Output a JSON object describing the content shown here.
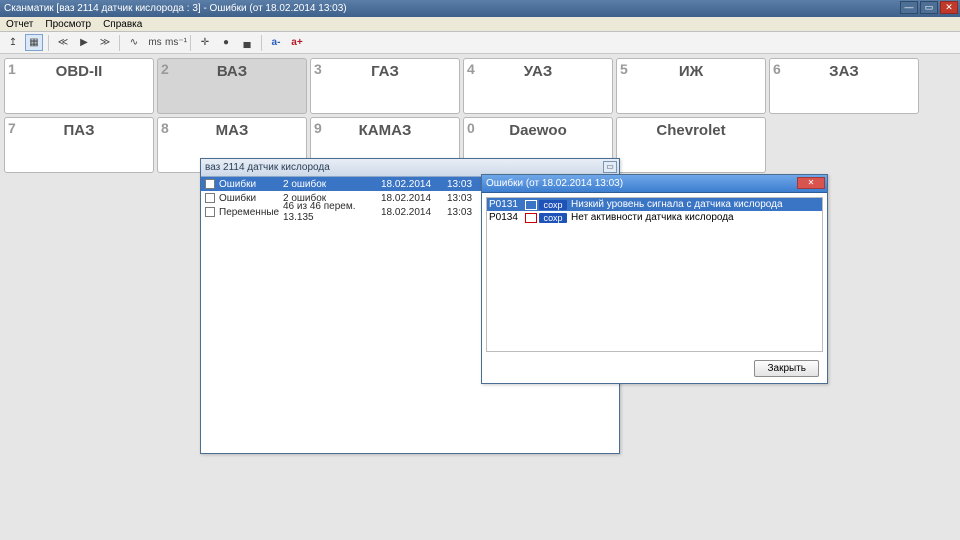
{
  "app": {
    "title": "Сканматик [ваз 2114 датчик кислорода : 3] - Ошибки (от 18.02.2014  13:03)"
  },
  "menu": {
    "report": "Отчет",
    "view": "Просмотр",
    "help": "Справка"
  },
  "cards": [
    {
      "num": "1",
      "label": "OBD-II"
    },
    {
      "num": "2",
      "label": "ВАЗ",
      "selected": true
    },
    {
      "num": "3",
      "label": "ГАЗ"
    },
    {
      "num": "4",
      "label": "УАЗ"
    },
    {
      "num": "5",
      "label": "ИЖ"
    },
    {
      "num": "6",
      "label": "ЗАЗ"
    },
    {
      "num": "7",
      "label": "ПАЗ"
    },
    {
      "num": "8",
      "label": "МАЗ"
    },
    {
      "num": "9",
      "label": "КАМАЗ"
    },
    {
      "num": "0",
      "label": "Daewoo"
    },
    {
      "num": "",
      "label": "Chevrolet"
    }
  ],
  "listwin": {
    "title": "ваз 2114 датчик кислорода",
    "rows": [
      {
        "name": "Ошибки",
        "info": "2 ошибок",
        "date": "18.02.2014",
        "time": "13:03",
        "selected": true
      },
      {
        "name": "Ошибки",
        "info": "2 ошибок",
        "date": "18.02.2014",
        "time": "13:03"
      },
      {
        "name": "Переменные",
        "info": "46 из 46 перем. 13.135",
        "date": "18.02.2014",
        "time": "13:03"
      }
    ]
  },
  "errwin": {
    "title": "Ошибки (от 18.02.2014  13:03)",
    "rows": [
      {
        "code": "P0131",
        "tag": "сохр",
        "desc": "Низкий уровень сигнала с датчика кислорода",
        "selected": true
      },
      {
        "code": "P0134",
        "tag": "сохр",
        "desc": "Нет активности датчика кислорода"
      }
    ],
    "close": "Закрыть"
  },
  "toolbar": {
    "a_minus": "a-",
    "a_plus": "a+",
    "ms": "ms",
    "ms_s": "ms⁻¹"
  }
}
